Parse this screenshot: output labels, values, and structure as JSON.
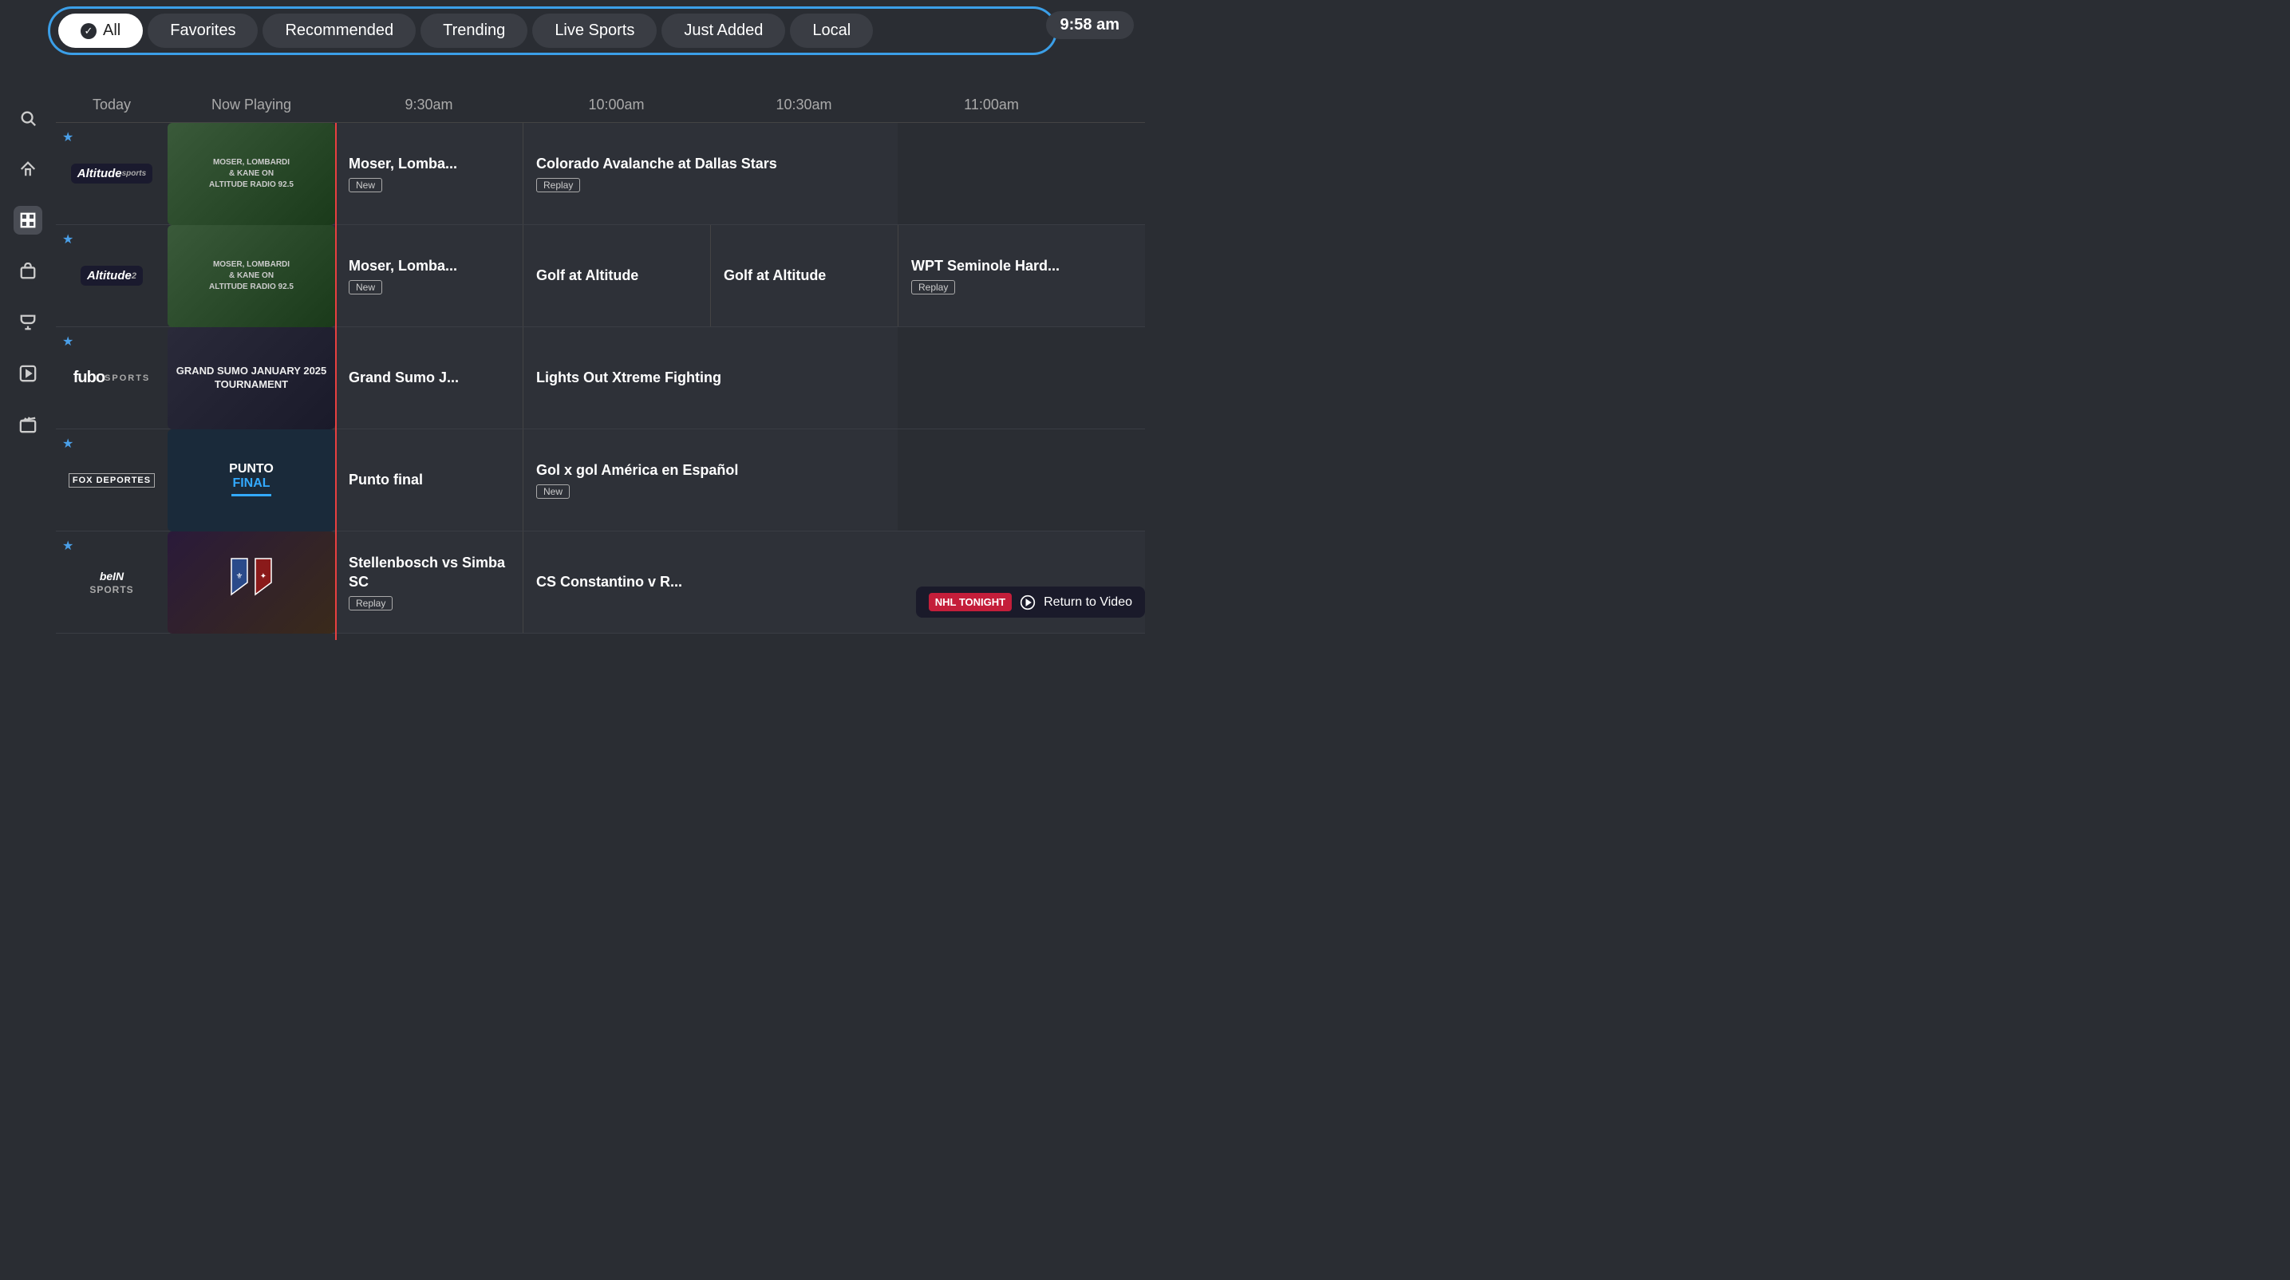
{
  "time": "9:58 am",
  "filter_bar": {
    "items": [
      {
        "id": "all",
        "label": "All",
        "active": true
      },
      {
        "id": "favorites",
        "label": "Favorites",
        "active": false
      },
      {
        "id": "recommended",
        "label": "Recommended",
        "active": false
      },
      {
        "id": "trending",
        "label": "Trending",
        "active": false
      },
      {
        "id": "live_sports",
        "label": "Live Sports",
        "active": false
      },
      {
        "id": "just_added",
        "label": "Just Added",
        "active": false
      },
      {
        "id": "local",
        "label": "Local",
        "active": false
      }
    ]
  },
  "timeline": {
    "columns": [
      "Today",
      "Now Playing",
      "9:30am",
      "10:00am",
      "10:30am",
      "11:00am"
    ]
  },
  "channels": [
    {
      "id": "altitude",
      "logo": "Altitude Sports",
      "logo_style": "altitude",
      "favorited": true,
      "thumbnail_type": "radio",
      "thumbnail_text": "MOSER, LOMBARDI & KANE ON ALTITUDE RADIO 92.5",
      "programs": [
        {
          "title": "Moser, Lomba...",
          "badge": "New",
          "wide": false
        },
        {
          "title": "Colorado Avalanche at Dallas Stars",
          "badge": "Replay",
          "wide": true
        }
      ]
    },
    {
      "id": "altitude2",
      "logo": "Altitude 2",
      "logo_style": "altitude2",
      "favorited": true,
      "thumbnail_type": "radio",
      "thumbnail_text": "MOSER, LOMBARDI & KANE ON ALTITUDE RADIO 92.5",
      "programs": [
        {
          "title": "Moser, Lomba...",
          "badge": "New",
          "wide": false
        },
        {
          "title": "Golf at Altitude",
          "badge": null,
          "wide": false
        },
        {
          "title": "Golf at Altitude",
          "badge": null,
          "wide": false
        },
        {
          "title": "WPT Seminole Hard...",
          "badge": "Replay",
          "partial": true
        }
      ]
    },
    {
      "id": "fubo_sports",
      "logo": "fubo SPORTS",
      "logo_style": "fubo",
      "favorited": true,
      "thumbnail_type": "sumo",
      "thumbnail_text": "GRAND SUMO JANUARY 2025 TOURNAMENT",
      "programs": [
        {
          "title": "Grand Sumo J...",
          "badge": null,
          "wide": false
        },
        {
          "title": "Lights Out Xtreme Fighting",
          "badge": null,
          "wide": true
        }
      ]
    },
    {
      "id": "fox_deportes",
      "logo": "FOX DEPORTES",
      "logo_style": "foxd",
      "favorited": true,
      "thumbnail_type": "punto",
      "thumbnail_text": "Punto Final",
      "programs": [
        {
          "title": "Punto final",
          "badge": null,
          "wide": false
        },
        {
          "title": "Gol x gol América en Español",
          "badge": "New",
          "wide": true
        }
      ]
    },
    {
      "id": "bein_sports",
      "logo": "beIN SPORTS",
      "logo_style": "bein",
      "favorited": true,
      "thumbnail_type": "futbol",
      "thumbnail_text": "Stellenbosch vs Simba SC",
      "programs": [
        {
          "title": "Stellenbosch vs Simba SC",
          "badge": "Replay",
          "wide": false
        },
        {
          "title": "CS Constantino v R...",
          "badge": null,
          "cs": true
        }
      ]
    }
  ],
  "return_to_video": {
    "badge": "NHL TONIGHT",
    "label": "Return to Video"
  },
  "sidebar_icons": [
    {
      "id": "search",
      "symbol": "🔍"
    },
    {
      "id": "home",
      "symbol": "⌂"
    },
    {
      "id": "guide",
      "symbol": "▦"
    },
    {
      "id": "bag",
      "symbol": "🎒"
    },
    {
      "id": "trophy",
      "symbol": "🏆"
    },
    {
      "id": "play",
      "symbol": "▶"
    },
    {
      "id": "clap",
      "symbol": "🎬"
    }
  ]
}
